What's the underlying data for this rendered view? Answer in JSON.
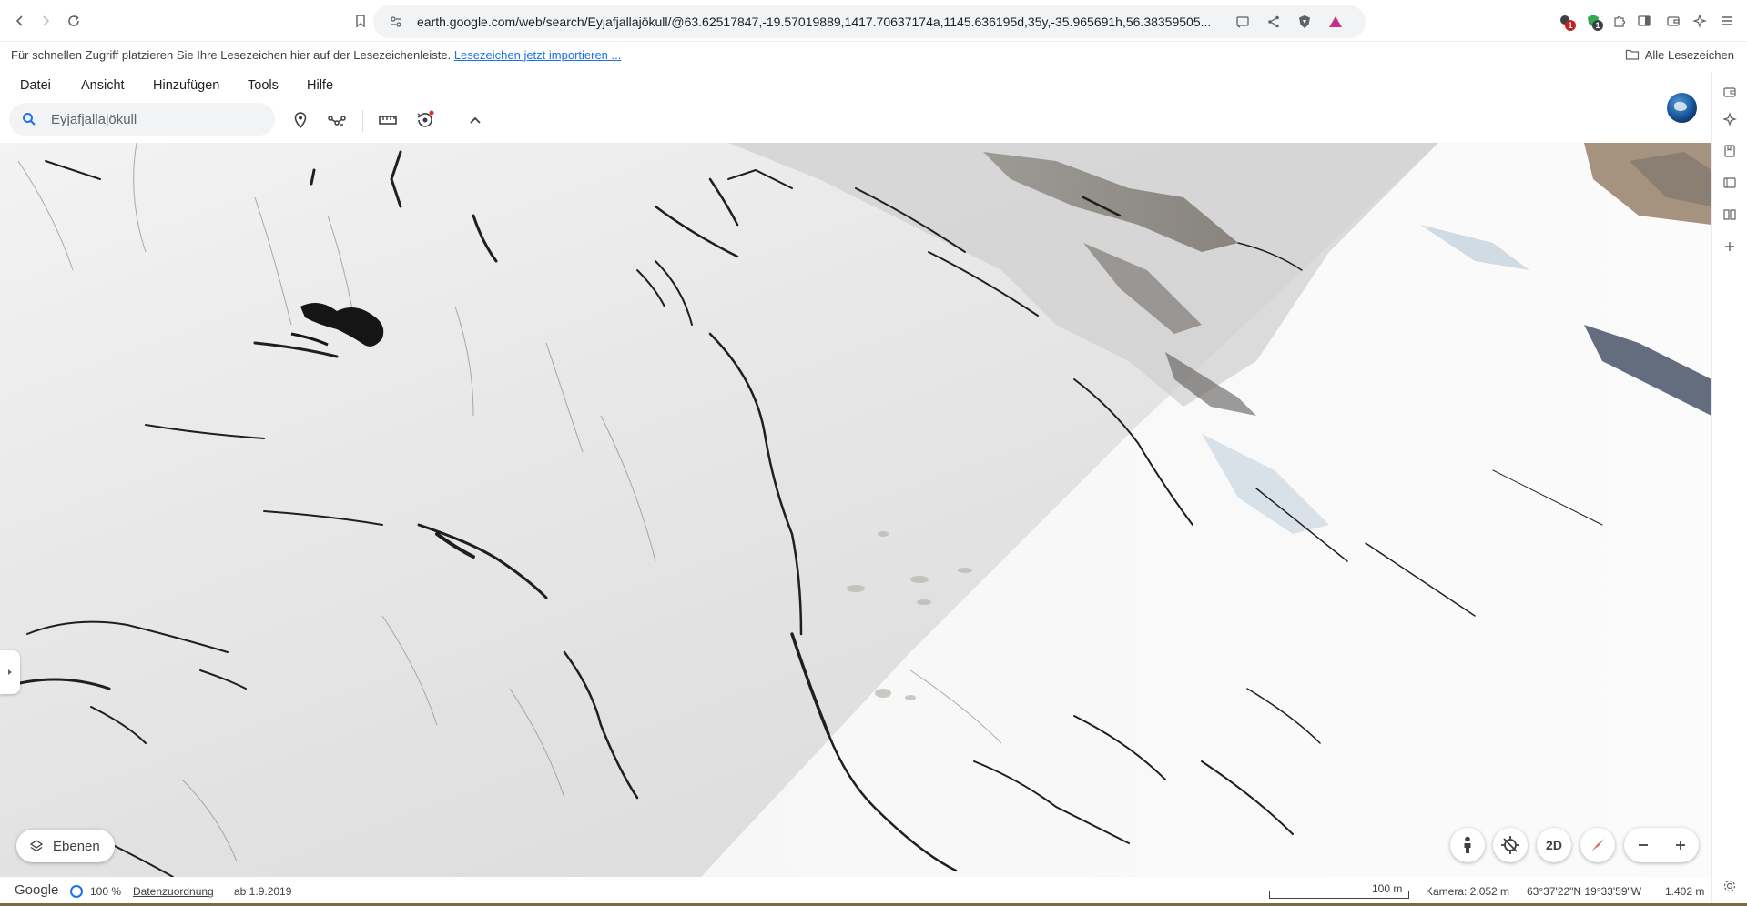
{
  "browser": {
    "url": "earth.google.com/web/search/Eyjafjallajökull/@63.62517847,-19.57019889,1417.70637174a,1145.636195d,35y,-35.965691h,56.38359505...",
    "bookmark_hint": "Für schnellen Zugriff platzieren Sie Ihre Lesezeichen hier auf der Lesezeichenleiste.",
    "bookmark_import_link": "Lesezeichen jetzt importieren ...",
    "all_bookmarks": "Alle Lesezeichen",
    "ext_badge_1": "1",
    "ext_badge_2": "1"
  },
  "menu": {
    "file": "Datei",
    "view": "Ansicht",
    "add": "Hinzufügen",
    "tools": "Tools",
    "help": "Hilfe"
  },
  "search": {
    "value": "Eyjafjallajökull"
  },
  "map_controls": {
    "layers_label": "Ebenen",
    "mode_2d": "2D"
  },
  "status": {
    "google": "Google",
    "load_percent": "100 %",
    "data_attribution": "Datenzuordnung",
    "imagery_date": "ab 1.9.2019",
    "scale": "100 m",
    "camera": "Kamera: 2.052 m",
    "coordinates": "63°37'22\"N 19°33'59\"W",
    "elevation": "1.402 m"
  },
  "colors": {
    "accent": "#1a73e8",
    "toolbar_bg": "#ffffff",
    "search_bg": "#f1f3f4"
  }
}
